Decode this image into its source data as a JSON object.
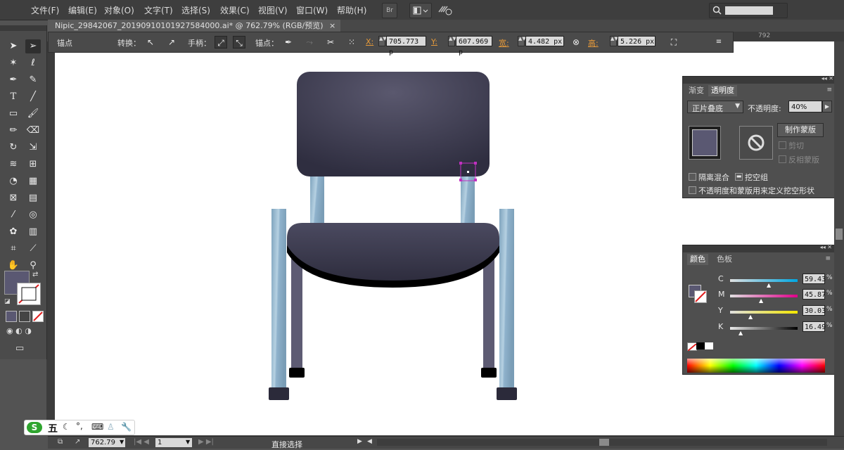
{
  "menubar": {
    "items": [
      "文件(F)",
      "编辑(E)",
      "对象(O)",
      "文字(T)",
      "选择(S)",
      "效果(C)",
      "视图(V)",
      "窗口(W)",
      "帮助(H)"
    ],
    "br_label": "Br"
  },
  "document_tab": {
    "title": "Nipic_29842067_20190910101927584000.ai* @ 762.79% (RGB/预览)",
    "close": "×"
  },
  "ruler": {
    "mark_792": "792"
  },
  "control_bar": {
    "anchor_label": "锚点",
    "convert_label": "转换：",
    "handle_label": "手柄：",
    "anchor_points_label": "锚点：",
    "x_label": "X:",
    "x_value": "705.773 p",
    "y_label": "Y:",
    "y_value": "607.969 p",
    "w_label": "宽:",
    "w_value": "4.482 px",
    "h_label": "高:",
    "h_value": "5.226 px"
  },
  "toolbox": {
    "tools": [
      "selection-tool",
      "direct-selection-tool",
      "magic-wand-tool",
      "lasso-tool",
      "pen-tool",
      "curvature-tool",
      "type-tool",
      "line-tool",
      "rectangle-tool",
      "paintbrush-tool",
      "pencil-tool",
      "eraser-tool",
      "rotate-tool",
      "scale-tool",
      "width-tool",
      "free-transform-tool",
      "shape-builder-tool",
      "perspective-grid-tool",
      "mesh-tool",
      "gradient-tool",
      "eyedropper-tool",
      "blend-tool",
      "symbol-sprayer-tool",
      "column-graph-tool",
      "artboard-tool",
      "slice-tool",
      "hand-tool",
      "zoom-tool"
    ],
    "fill_color": "#5a5872"
  },
  "transparency_panel": {
    "tab_gradient": "渐变",
    "tab_transparency": "透明度",
    "blend_mode": "正片叠底",
    "opacity_label": "不透明度:",
    "opacity_value": "40%",
    "make_mask_button": "制作蒙版",
    "clip_label": "剪切",
    "invert_mask_label": "反相蒙版",
    "isolate_blending_label": "隔离混合",
    "knockout_group_label": "挖空组",
    "opacity_mask_label": "不透明度和蒙版用来定义挖空形状"
  },
  "color_panel": {
    "tab_color": "颜色",
    "tab_swatches": "色板",
    "channels": [
      {
        "label": "C",
        "value": "59.43",
        "percent": 0.59,
        "gradient": "linear-gradient(90deg,#e0e0e0,#00a6e0)"
      },
      {
        "label": "M",
        "value": "45.87",
        "percent": 0.46,
        "gradient": "linear-gradient(90deg,#e0e0e0,#e0008a)"
      },
      {
        "label": "Y",
        "value": "30.03",
        "percent": 0.3,
        "gradient": "linear-gradient(90deg,#e0e0e0,#f2e600)"
      },
      {
        "label": "K",
        "value": "16.49",
        "percent": 0.16,
        "gradient": "linear-gradient(90deg,#e8e8e8,#000000)"
      }
    ],
    "percent_sign": "%",
    "swatch_color": "#5a5872"
  },
  "status_bar": {
    "zoom": "762.79",
    "artboard": "1",
    "current_tool": "直接选择"
  },
  "ime_bar": {
    "logo": "S",
    "mode": "五",
    "punct": "°,"
  },
  "artwork": {
    "backrest_color": "#3b3a50",
    "seat_color": "#3d3c52",
    "leg_color": "#8fb2cc",
    "rear_leg_color": "#5a5870",
    "foot_color": "#2c2c3c"
  }
}
